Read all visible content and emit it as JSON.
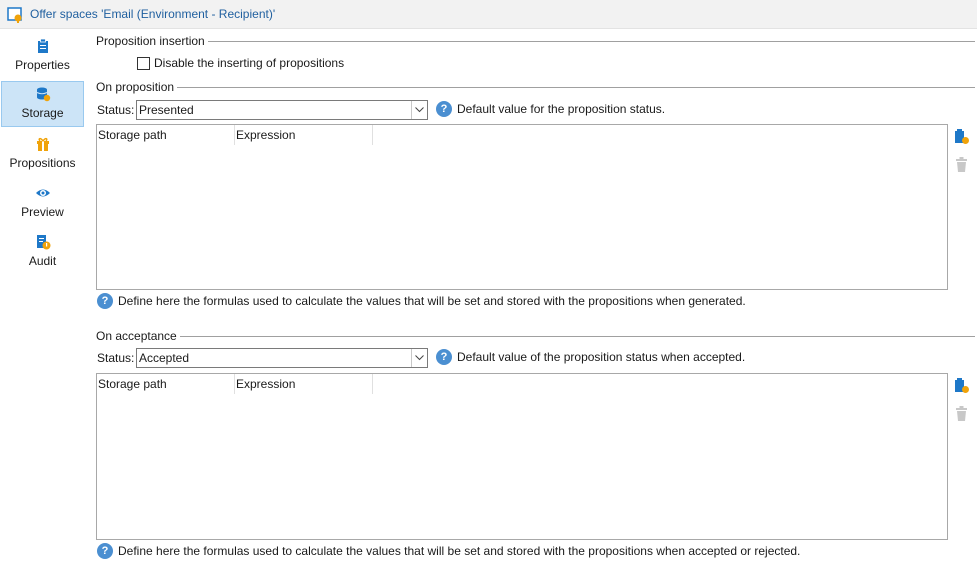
{
  "window": {
    "title": "Offer spaces 'Email (Environment - Recipient)'"
  },
  "sidebar": {
    "items": [
      {
        "label": "Properties",
        "icon": "clipboard-icon",
        "active": false
      },
      {
        "label": "Storage",
        "icon": "database-icon",
        "active": true
      },
      {
        "label": "Propositions",
        "icon": "gift-icon",
        "active": false
      },
      {
        "label": "Preview",
        "icon": "eye-icon",
        "active": false
      },
      {
        "label": "Audit",
        "icon": "audit-icon",
        "active": false
      }
    ]
  },
  "proposition_insertion": {
    "title": "Proposition insertion",
    "checkbox_label": "Disable the inserting of propositions",
    "checked": false
  },
  "on_proposition": {
    "title": "On proposition",
    "status_label": "Status:",
    "status_value": "Presented",
    "status_help": "Default value for the proposition status.",
    "columns": [
      "Storage path",
      "Expression"
    ],
    "rows": [],
    "footer_help": "Define here the formulas used to calculate the values that will be set and stored with the propositions when generated."
  },
  "on_acceptance": {
    "title": "On acceptance",
    "status_label": "Status:",
    "status_value": "Accepted",
    "status_help": "Default value of the proposition status when accepted.",
    "columns": [
      "Storage path",
      "Expression"
    ],
    "rows": [],
    "footer_help": "Define here the formulas used to calculate the values that will be set and stored with the propositions when accepted or rejected."
  },
  "colors": {
    "accent": "#1f5f9f",
    "help": "#4b8fd1",
    "selected_bg": "#cce4f7",
    "icon_blue": "#1e78c8",
    "icon_orange": "#f0a30a"
  }
}
